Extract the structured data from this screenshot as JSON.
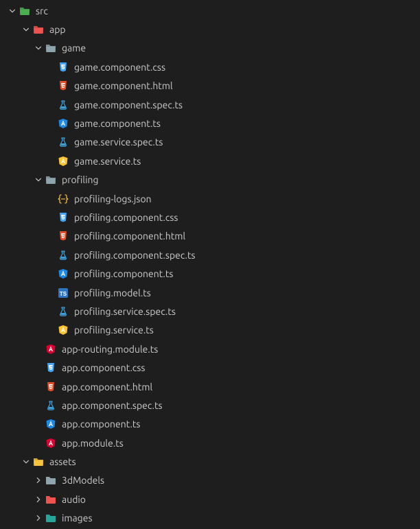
{
  "tree": [
    {
      "depth": 0,
      "kind": "folder",
      "expanded": true,
      "icon": "folder-src",
      "name": "src"
    },
    {
      "depth": 1,
      "kind": "folder",
      "expanded": true,
      "icon": "folder-app",
      "name": "app"
    },
    {
      "depth": 2,
      "kind": "folder",
      "expanded": true,
      "icon": "folder-generic-open",
      "name": "game"
    },
    {
      "depth": 3,
      "kind": "file",
      "icon": "css",
      "name": "game.component.css"
    },
    {
      "depth": 3,
      "kind": "file",
      "icon": "html",
      "name": "game.component.html"
    },
    {
      "depth": 3,
      "kind": "file",
      "icon": "test",
      "name": "game.component.spec.ts"
    },
    {
      "depth": 3,
      "kind": "file",
      "icon": "angular-ts",
      "name": "game.component.ts"
    },
    {
      "depth": 3,
      "kind": "file",
      "icon": "test",
      "name": "game.service.spec.ts"
    },
    {
      "depth": 3,
      "kind": "file",
      "icon": "angular-service",
      "name": "game.service.ts"
    },
    {
      "depth": 2,
      "kind": "folder",
      "expanded": true,
      "icon": "folder-generic-open",
      "name": "profiling"
    },
    {
      "depth": 3,
      "kind": "file",
      "icon": "json",
      "name": "profiling-logs.json"
    },
    {
      "depth": 3,
      "kind": "file",
      "icon": "css",
      "name": "profiling.component.css"
    },
    {
      "depth": 3,
      "kind": "file",
      "icon": "html",
      "name": "profiling.component.html"
    },
    {
      "depth": 3,
      "kind": "file",
      "icon": "test",
      "name": "profiling.component.spec.ts"
    },
    {
      "depth": 3,
      "kind": "file",
      "icon": "angular-ts",
      "name": "profiling.component.ts"
    },
    {
      "depth": 3,
      "kind": "file",
      "icon": "ts",
      "name": "profiling.model.ts"
    },
    {
      "depth": 3,
      "kind": "file",
      "icon": "test",
      "name": "profiling.service.spec.ts"
    },
    {
      "depth": 3,
      "kind": "file",
      "icon": "angular-service",
      "name": "profiling.service.ts"
    },
    {
      "depth": 2,
      "kind": "file",
      "icon": "angular-module-red",
      "name": "app-routing.module.ts"
    },
    {
      "depth": 2,
      "kind": "file",
      "icon": "css",
      "name": "app.component.css"
    },
    {
      "depth": 2,
      "kind": "file",
      "icon": "html",
      "name": "app.component.html"
    },
    {
      "depth": 2,
      "kind": "file",
      "icon": "test",
      "name": "app.component.spec.ts"
    },
    {
      "depth": 2,
      "kind": "file",
      "icon": "angular-ts",
      "name": "app.component.ts"
    },
    {
      "depth": 2,
      "kind": "file",
      "icon": "angular-module-red",
      "name": "app.module.ts"
    },
    {
      "depth": 1,
      "kind": "folder",
      "expanded": true,
      "icon": "folder-assets",
      "name": "assets"
    },
    {
      "depth": 2,
      "kind": "folder",
      "expanded": false,
      "icon": "folder-generic",
      "name": "3dModels"
    },
    {
      "depth": 2,
      "kind": "folder",
      "expanded": false,
      "icon": "folder-audio",
      "name": "audio"
    },
    {
      "depth": 2,
      "kind": "folder",
      "expanded": false,
      "icon": "folder-images",
      "name": "images"
    }
  ],
  "colors": {
    "css": "#42a5f5",
    "html": "#e44d26",
    "test": "#3f9fd8",
    "angularBlue": "#1e88e5",
    "angularYellow": "#f9c332",
    "angularRed": "#dd0031",
    "json": "#f0b93a",
    "ts": "#2f74c0",
    "folder": "#90a4ae",
    "folderSrc": "#4caf50",
    "folderApp": "#ef5350",
    "folderAssets": "#f6c33c",
    "folderAudio": "#ef5350",
    "folderImages": "#26a69a",
    "chevron": "#c5c5c5"
  }
}
